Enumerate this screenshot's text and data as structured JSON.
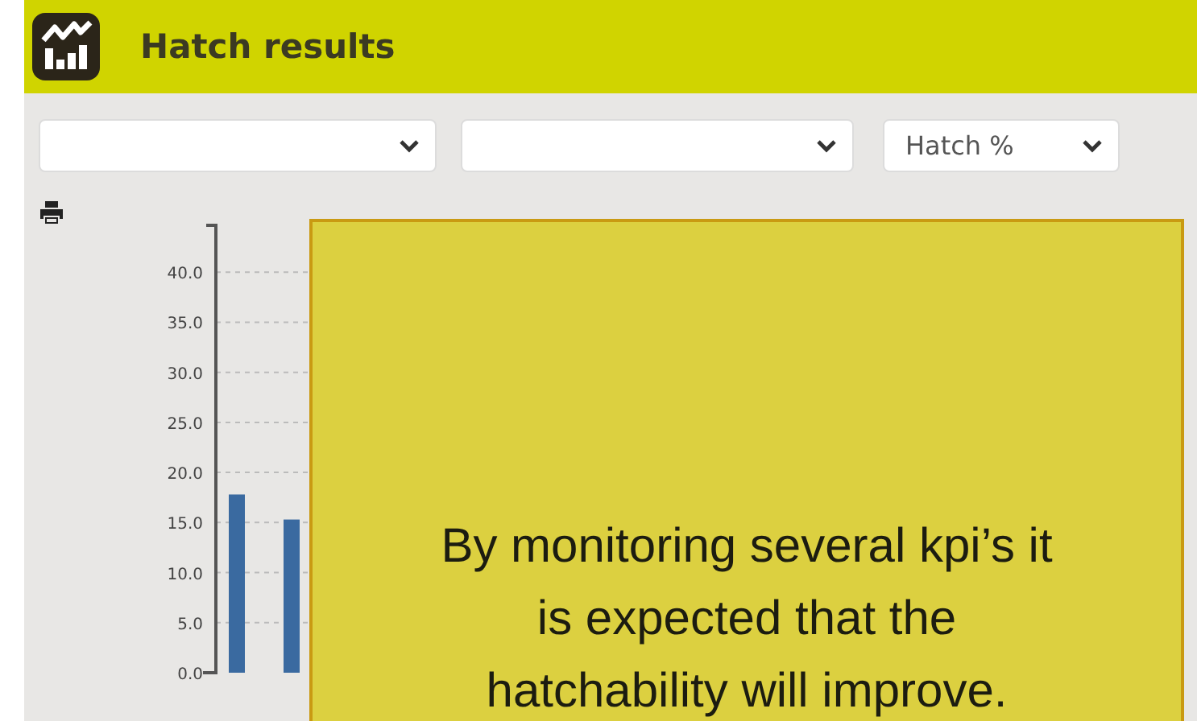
{
  "header": {
    "title": "Hatch results"
  },
  "filters": [
    {
      "expanded": false
    },
    {
      "expanded": false
    },
    {
      "value": "Hatch %",
      "expanded": false
    }
  ],
  "chart": {
    "chart_data": {
      "type": "bar",
      "categories": [
        null,
        null
      ],
      "values": [
        17.8,
        15.3
      ],
      "ylim": [
        0,
        45
      ],
      "grid": true,
      "yticks": [
        {
          "value": 0,
          "label": "0.0"
        },
        {
          "value": 5,
          "label": "5.0"
        },
        {
          "value": 10,
          "label": "10.0"
        },
        {
          "value": 15,
          "label": "15.0"
        },
        {
          "value": 20,
          "label": "20.0"
        },
        {
          "value": 25,
          "label": "25.0"
        },
        {
          "value": 30,
          "label": "30.0"
        },
        {
          "value": 35,
          "label": "35.0"
        },
        {
          "value": 40,
          "label": "40.0"
        }
      ]
    }
  },
  "callout": {
    "text": "By monitoring several kpi’s it is expected that the hatchability will improve."
  }
}
